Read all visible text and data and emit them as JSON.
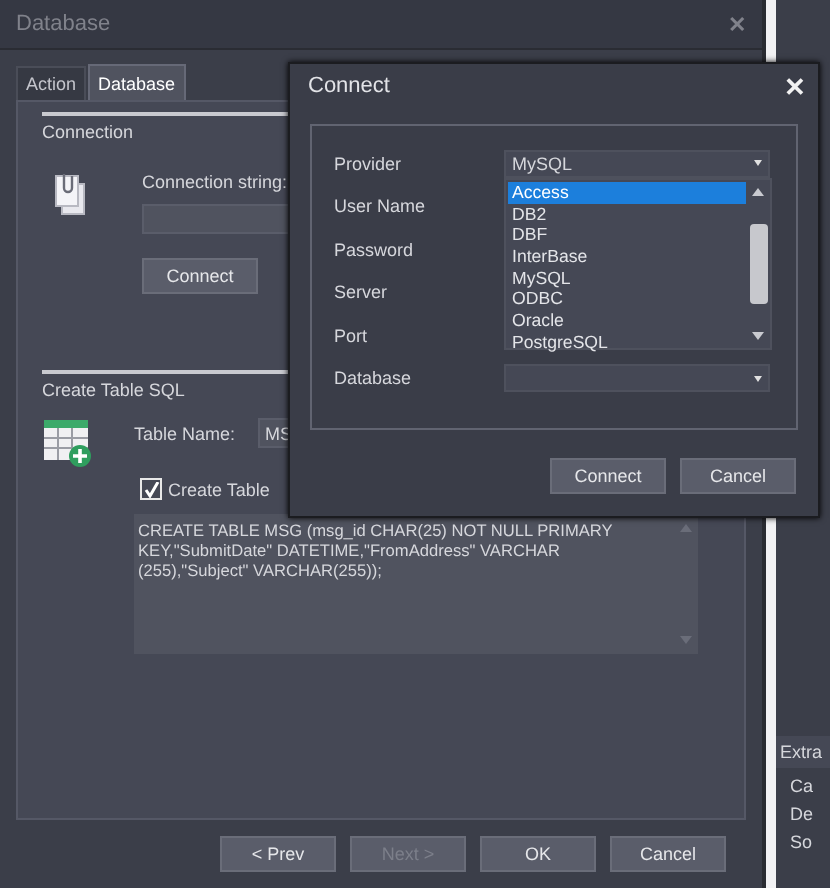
{
  "main_window": {
    "title": "Database",
    "close": "✕",
    "tabs": [
      {
        "label": "Action",
        "selected": false
      },
      {
        "label": "Database",
        "selected": true
      }
    ],
    "connection": {
      "heading": "Connection",
      "string_label": "Connection string:",
      "connect_button": "Connect"
    },
    "create_table": {
      "heading": "Create Table SQL",
      "table_name_label": "Table Name:",
      "table_name_value": "MS",
      "create_table_label": "Create Table",
      "create_table_checked": true,
      "sql": "CREATE TABLE MSG (msg_id CHAR(25) NOT NULL PRIMARY KEY,\"SubmitDate\" DATETIME,\"FromAddress\" VARCHAR (255),\"Subject\" VARCHAR(255));"
    },
    "buttons": [
      {
        "label": "< Prev",
        "disabled": false
      },
      {
        "label": "Next >",
        "disabled": true
      },
      {
        "label": "OK",
        "disabled": false
      },
      {
        "label": "Cancel",
        "disabled": false
      }
    ]
  },
  "side_window": {
    "section": "Extra",
    "items": [
      "Ca",
      "De",
      "So"
    ]
  },
  "connect_dialog": {
    "title": "Connect",
    "close": "✕",
    "fields": [
      {
        "label": "Provider",
        "kind": "combo",
        "value": "MySQL"
      },
      {
        "label": "User Name",
        "kind": "text"
      },
      {
        "label": "Password",
        "kind": "text"
      },
      {
        "label": "Server",
        "kind": "text"
      },
      {
        "label": "Port",
        "kind": "text"
      },
      {
        "label": "Database",
        "kind": "combo"
      }
    ],
    "provider_list": [
      {
        "label": "Access",
        "selected": true
      },
      {
        "label": "DB2",
        "selected": false
      },
      {
        "label": "DBF",
        "selected": false
      },
      {
        "label": "InterBase",
        "selected": false
      },
      {
        "label": "MySQL",
        "selected": false
      },
      {
        "label": "ODBC",
        "selected": false
      },
      {
        "label": "Oracle",
        "selected": false
      },
      {
        "label": "PostgreSQL",
        "selected": false
      }
    ],
    "buttons": [
      "Connect",
      "Cancel"
    ]
  }
}
